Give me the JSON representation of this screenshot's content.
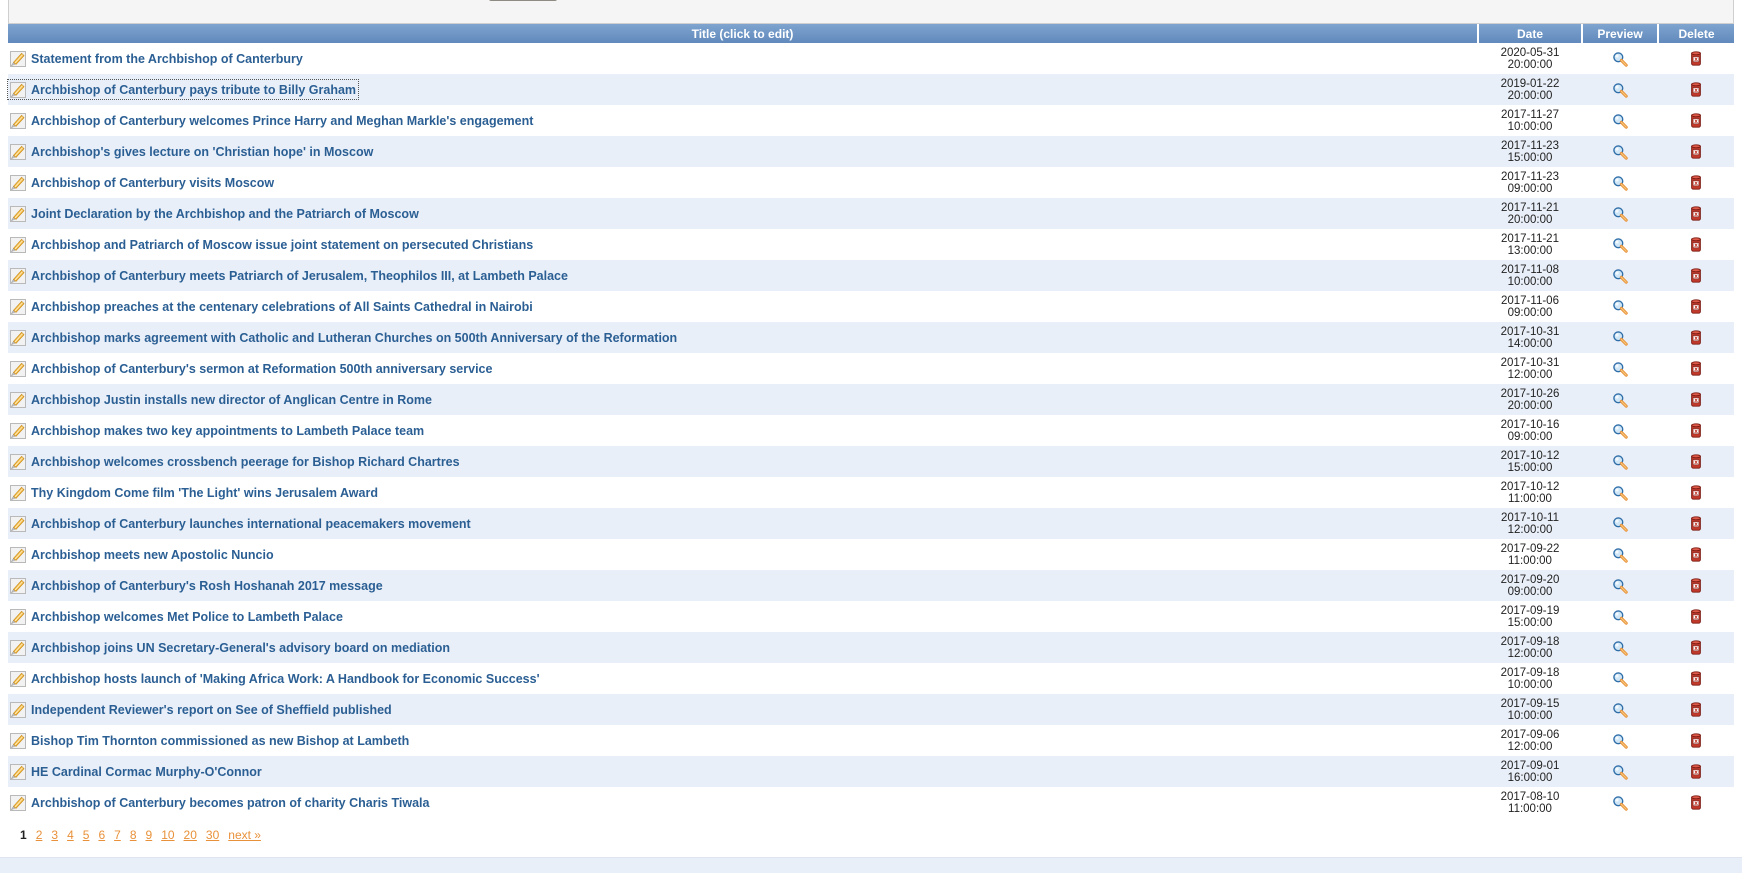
{
  "top_panel": {
    "button_label": ""
  },
  "table": {
    "columns": {
      "title": "Title (click to edit)",
      "date": "Date",
      "preview": "Preview",
      "delete": "Delete"
    },
    "rows": [
      {
        "title": "Statement from the Archbishop of Canterbury",
        "date": "2020-05-31",
        "time": "20:00:00",
        "focused": false
      },
      {
        "title": "Archbishop of Canterbury pays tribute to Billy Graham",
        "date": "2019-01-22",
        "time": "20:00:00",
        "focused": true
      },
      {
        "title": "Archbishop of Canterbury welcomes Prince Harry and Meghan Markle's engagement",
        "date": "2017-11-27",
        "time": "10:00:00",
        "focused": false
      },
      {
        "title": "Archbishop's gives lecture on 'Christian hope' in Moscow",
        "date": "2017-11-23",
        "time": "15:00:00",
        "focused": false
      },
      {
        "title": "Archbishop of Canterbury visits Moscow",
        "date": "2017-11-23",
        "time": "09:00:00",
        "focused": false
      },
      {
        "title": "Joint Declaration by the Archbishop and the Patriarch of Moscow",
        "date": "2017-11-21",
        "time": "20:00:00",
        "focused": false
      },
      {
        "title": "Archbishop and Patriarch of Moscow issue joint statement on persecuted Christians",
        "date": "2017-11-21",
        "time": "13:00:00",
        "focused": false
      },
      {
        "title": "Archbishop of Canterbury meets Patriarch of Jerusalem, Theophilos III, at Lambeth Palace",
        "date": "2017-11-08",
        "time": "10:00:00",
        "focused": false
      },
      {
        "title": "Archbishop preaches at the centenary celebrations of All Saints Cathedral in Nairobi",
        "date": "2017-11-06",
        "time": "09:00:00",
        "focused": false
      },
      {
        "title": "Archbishop marks agreement with Catholic and Lutheran Churches on 500th Anniversary of the Reformation",
        "date": "2017-10-31",
        "time": "14:00:00",
        "focused": false
      },
      {
        "title": "Archbishop of Canterbury's sermon at Reformation 500th anniversary service",
        "date": "2017-10-31",
        "time": "12:00:00",
        "focused": false
      },
      {
        "title": "Archbishop Justin installs new director of Anglican Centre in Rome",
        "date": "2017-10-26",
        "time": "20:00:00",
        "focused": false
      },
      {
        "title": "Archbishop makes two key appointments to Lambeth Palace team",
        "date": "2017-10-16",
        "time": "09:00:00",
        "focused": false
      },
      {
        "title": "Archbishop welcomes crossbench peerage for Bishop Richard Chartres",
        "date": "2017-10-12",
        "time": "15:00:00",
        "focused": false
      },
      {
        "title": "Thy Kingdom Come film 'The Light' wins Jerusalem Award",
        "date": "2017-10-12",
        "time": "11:00:00",
        "focused": false
      },
      {
        "title": "Archbishop of Canterbury launches international peacemakers movement",
        "date": "2017-10-11",
        "time": "12:00:00",
        "focused": false
      },
      {
        "title": "Archbishop meets new Apostolic Nuncio",
        "date": "2017-09-22",
        "time": "11:00:00",
        "focused": false
      },
      {
        "title": "Archbishop of Canterbury's Rosh Hoshanah 2017 message",
        "date": "2017-09-20",
        "time": "09:00:00",
        "focused": false
      },
      {
        "title": "Archbishop welcomes Met Police to Lambeth Palace",
        "date": "2017-09-19",
        "time": "15:00:00",
        "focused": false
      },
      {
        "title": "Archbishop joins UN Secretary-General's advisory board on mediation",
        "date": "2017-09-18",
        "time": "12:00:00",
        "focused": false
      },
      {
        "title": "Archbishop hosts launch of 'Making Africa Work: A Handbook for Economic Success'",
        "date": "2017-09-18",
        "time": "10:00:00",
        "focused": false
      },
      {
        "title": "Independent Reviewer's report on See of Sheffield published",
        "date": "2017-09-15",
        "time": "10:00:00",
        "focused": false
      },
      {
        "title": "Bishop Tim Thornton commissioned as new Bishop at Lambeth",
        "date": "2017-09-06",
        "time": "12:00:00",
        "focused": false
      },
      {
        "title": "HE Cardinal Cormac Murphy-O'Connor",
        "date": "2017-09-01",
        "time": "16:00:00",
        "focused": false
      },
      {
        "title": "Archbishop of Canterbury becomes patron of charity Charis Tiwala",
        "date": "2017-08-10",
        "time": "11:00:00",
        "focused": false
      }
    ]
  },
  "pagination": {
    "current": "1",
    "pages": [
      "2",
      "3",
      "4",
      "5",
      "6",
      "7",
      "8",
      "9",
      "10",
      "20",
      "30"
    ],
    "next_label": "next »"
  },
  "icons": {
    "edit": "edit-pencil-icon",
    "preview": "magnifier-icon",
    "delete": "delete-bin-icon"
  },
  "colors": {
    "header_blue": "#6189bc",
    "link_blue": "#2b5f94",
    "row_alt": "#e9eff8",
    "pagination_orange": "#e8913a",
    "delete_red": "#c0392b"
  }
}
